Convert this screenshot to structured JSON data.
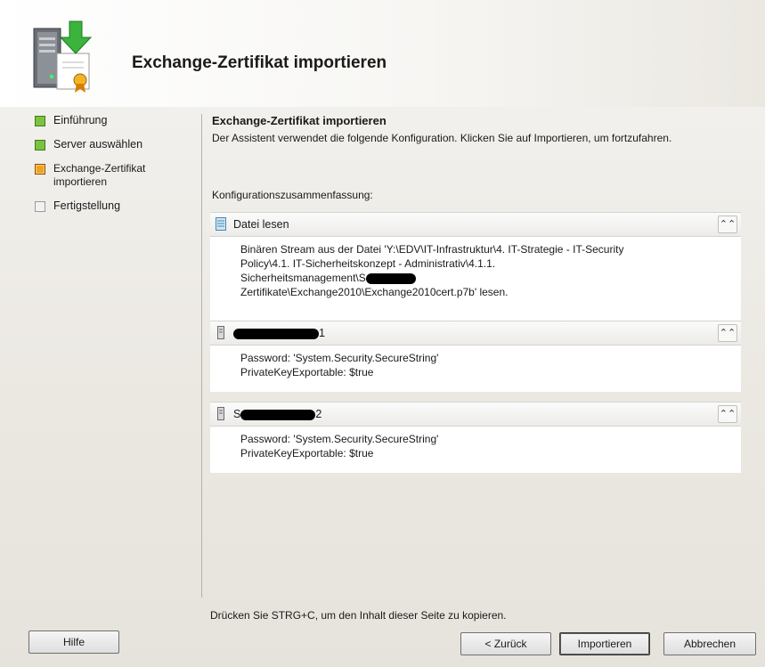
{
  "header": {
    "title": "Exchange-Zertifikat importieren"
  },
  "nav": {
    "items": [
      {
        "label": "Einführung",
        "status": "done"
      },
      {
        "label": "Server auswählen",
        "status": "done"
      },
      {
        "label": "Exchange-Zertifikat importieren",
        "status": "current"
      },
      {
        "label": "Fertigstellung",
        "status": "pending"
      }
    ]
  },
  "main": {
    "title": "Exchange-Zertifikat importieren",
    "description": "Der Assistent verwendet die folgende Konfiguration. Klicken Sie auf Importieren, um fortzufahren.",
    "summary_label": "Konfigurationszusammenfassung:",
    "sections": [
      {
        "title": "Datei lesen",
        "line1": "Binären Stream aus der Datei 'Y:\\EDV\\IT-Infrastruktur\\4. IT-Strategie - IT-Security",
        "line2": "Policy\\4.1. IT-Sicherheitskonzept - Administrativ\\4.1.1.",
        "line3": "Sicherheitsmanagement\\S",
        "line4": "Zertifikate\\Exchange2010\\Exchange2010cert.p7b' lesen."
      },
      {
        "title_suffix": "1",
        "line1": "Password: 'System.Security.SecureString'",
        "line2": "PrivateKeyExportable: $true"
      },
      {
        "title_prefix": "S",
        "title_suffix": "2",
        "line1": "Password: 'System.Security.SecureString'",
        "line2": "PrivateKeyExportable: $true"
      }
    ],
    "copy_hint": "Drücken Sie STRG+C, um den Inhalt dieser Seite zu kopieren."
  },
  "buttons": {
    "help": "Hilfe",
    "back": "< Zurück",
    "import": "Importieren",
    "cancel": "Abbrechen"
  },
  "colors": {
    "step_done": "#7cc240",
    "step_current": "#f0a21e",
    "step_pending": "#f2f2f2"
  },
  "icons": {
    "header": "server-certificate-import-icon",
    "collapse": "double-chevron-up-icon",
    "section": "document-icon"
  }
}
